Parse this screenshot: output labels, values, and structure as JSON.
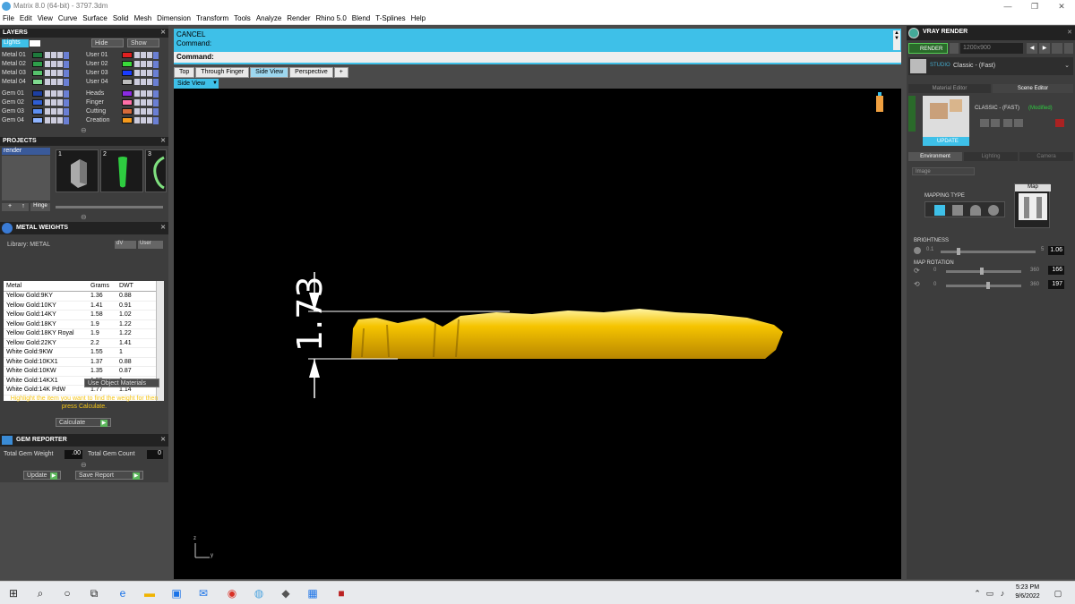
{
  "window": {
    "title": "Matrix 8.0 (64-bit) - 3797.3dm",
    "min": "—",
    "max": "❐",
    "close": "✕"
  },
  "menu": [
    "File",
    "Edit",
    "View",
    "Curve",
    "Surface",
    "Solid",
    "Mesh",
    "Dimension",
    "Transform",
    "Tools",
    "Analyze",
    "Render",
    "Rhino 5.0",
    "Blend",
    "T-Splines",
    "Help"
  ],
  "layers": {
    "title": "LAYERS",
    "lights": "Lights",
    "hide": "Hide",
    "show": "Show",
    "left": [
      {
        "name": "Metal 01",
        "color": "#1e7a3c"
      },
      {
        "name": "Metal 02",
        "color": "#2e9e4a"
      },
      {
        "name": "Metal 03",
        "color": "#56c26c"
      },
      {
        "name": "Metal 04",
        "color": "#7fd98f"
      },
      {
        "name": "Gem 01",
        "color": "#1d3fa0"
      },
      {
        "name": "Gem 02",
        "color": "#2f5ed2"
      },
      {
        "name": "Gem 03",
        "color": "#5c8ef0"
      },
      {
        "name": "Gem 04",
        "color": "#8fb4ff"
      }
    ],
    "right": [
      {
        "name": "User 01",
        "color": "#e02020"
      },
      {
        "name": "User 02",
        "color": "#3adb3a"
      },
      {
        "name": "User 03",
        "color": "#1a3cff"
      },
      {
        "name": "User 04",
        "color": "#bdbdbd"
      },
      {
        "name": "Heads",
        "color": "#8a2be2"
      },
      {
        "name": "Finger",
        "color": "#ff6fa8"
      },
      {
        "name": "Cutting",
        "color": "#d56a3a"
      },
      {
        "name": "Creation",
        "color": "#f59a1c"
      }
    ]
  },
  "projects": {
    "title": "PROJECTS",
    "item": "render",
    "thumbs": [
      "1",
      "2",
      "3"
    ],
    "hinge": "Hinge"
  },
  "metal_weights": {
    "title": "METAL WEIGHTS",
    "library": "Library: METAL",
    "columns": [
      "Metal",
      "Grams",
      "DWT"
    ],
    "rows": [
      [
        "Yellow Gold:9KY",
        "1.36",
        "0.88"
      ],
      [
        "Yellow Gold:10KY",
        "1.41",
        "0.91"
      ],
      [
        "Yellow Gold:14KY",
        "1.58",
        "1.02"
      ],
      [
        "Yellow Gold:18KY",
        "1.9",
        "1.22"
      ],
      [
        "Yellow Gold:18KY Royal",
        "1.9",
        "1.22"
      ],
      [
        "Yellow Gold:22KY",
        "2.2",
        "1.41"
      ],
      [
        "White Gold:9KW",
        "1.55",
        "1"
      ],
      [
        "White Gold:10KX1",
        "1.37",
        "0.88"
      ],
      [
        "White Gold:10KW",
        "1.35",
        "0.87"
      ],
      [
        "White Gold:14KX1",
        "1.55",
        "1"
      ],
      [
        "White Gold:14K PdW",
        "1.77",
        "1.14"
      ]
    ],
    "use_object_materials": "Use Object Materials",
    "hint": "Highlight the item you want to find the weight for then press Calculate.",
    "calculate": "Calculate"
  },
  "gem_reporter": {
    "title": "GEM REPORTER",
    "total_weight_label": "Total Gem Weight",
    "total_weight": ".00",
    "total_count_label": "Total Gem Count",
    "total_count": "0",
    "update": "Update",
    "save_report": "Save Report"
  },
  "command": {
    "line1": "CANCEL",
    "line2": "Command:",
    "prompt": "Command:"
  },
  "view_tabs": [
    "Top",
    "Through Finger",
    "Side View",
    "Perspective"
  ],
  "active_view": "Side View",
  "dimension": "1.73",
  "axis": {
    "z": "z",
    "y": "y"
  },
  "vray": {
    "title": "VRAY RENDER",
    "render": "RENDER",
    "resolution": "1200x900",
    "studio": "STUDIO",
    "preset": "Classic - (Fast)",
    "tabs": [
      "Material Editor",
      "Scene Editor"
    ],
    "scene_name": "CLASSIC - (FAST)",
    "modified": "(Modified)",
    "update": "UPDATE",
    "env_tabs": [
      "Environment",
      "Lighting",
      "Camera"
    ],
    "env_type": "Image",
    "mapping_type": "MAPPING TYPE",
    "map": "Map",
    "brightness_label": "BRIGHTNESS",
    "brightness_min": "0.1",
    "brightness_max": "5",
    "brightness": "1.06",
    "map_rotation": "MAP ROTATION",
    "rot1_min": "0",
    "rot1_max": "360",
    "rot1": "166",
    "rot2_min": "0",
    "rot2_max": "360",
    "rot2": "197"
  },
  "taskbar": {
    "time": "5:23 PM",
    "date": "9/6/2022"
  }
}
